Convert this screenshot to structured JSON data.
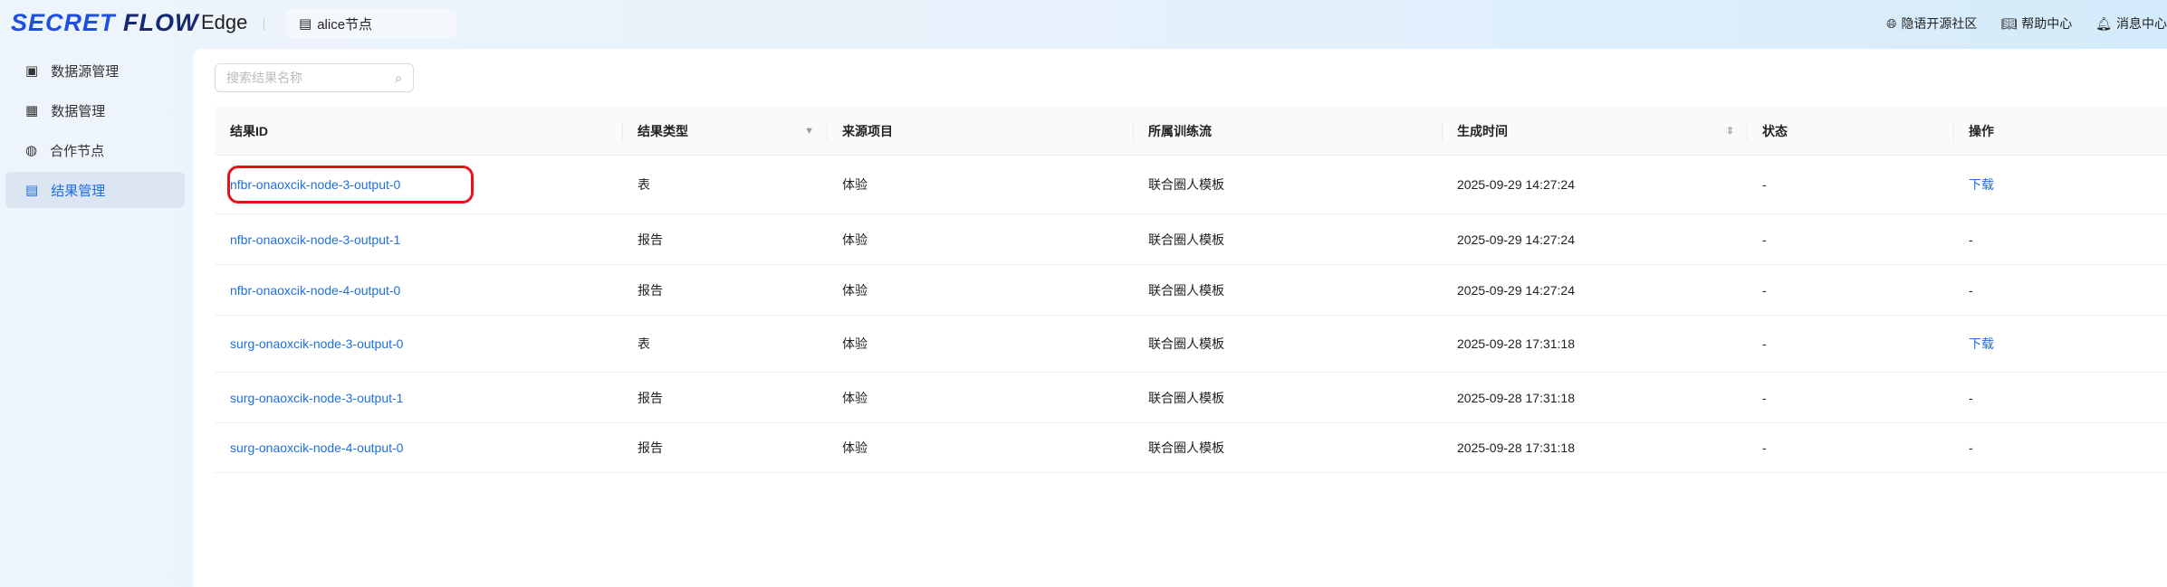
{
  "header": {
    "logo": "SECRET FLOW",
    "app": "Edge",
    "node": "alice节点",
    "links": [
      {
        "icon": "globe-icon",
        "label": "隐语开源社区"
      },
      {
        "icon": "book-icon",
        "label": "帮助中心"
      },
      {
        "icon": "bell-icon",
        "label": "消息中心"
      }
    ]
  },
  "sidebar": {
    "items": [
      {
        "label": "数据源管理"
      },
      {
        "label": "数据管理"
      },
      {
        "label": "合作节点"
      },
      {
        "label": "结果管理",
        "active": true
      }
    ]
  },
  "search": {
    "placeholder": "搜索结果名称"
  },
  "table": {
    "columns": [
      "结果ID",
      "结果类型",
      "来源项目",
      "所属训练流",
      "生成时间",
      "状态",
      "操作"
    ],
    "rows": [
      {
        "id": "nfbr-onaoxcik-node-3-output-0",
        "type": "表",
        "project": "体验",
        "flow": "联合圈人模板",
        "time": "2025-09-29 14:27:24",
        "status": "-",
        "action": "下载"
      },
      {
        "id": "nfbr-onaoxcik-node-3-output-1",
        "type": "报告",
        "project": "体验",
        "flow": "联合圈人模板",
        "time": "2025-09-29 14:27:24",
        "status": "-",
        "action": "-"
      },
      {
        "id": "nfbr-onaoxcik-node-4-output-0",
        "type": "报告",
        "project": "体验",
        "flow": "联合圈人模板",
        "time": "2025-09-29 14:27:24",
        "status": "-",
        "action": "-"
      },
      {
        "id": "surg-onaoxcik-node-3-output-0",
        "type": "表",
        "project": "体验",
        "flow": "联合圈人模板",
        "time": "2025-09-28 17:31:18",
        "status": "-",
        "action": "下载"
      },
      {
        "id": "surg-onaoxcik-node-3-output-1",
        "type": "报告",
        "project": "体验",
        "flow": "联合圈人模板",
        "time": "2025-09-28 17:31:18",
        "status": "-",
        "action": "-"
      },
      {
        "id": "surg-onaoxcik-node-4-output-0",
        "type": "报告",
        "project": "体验",
        "flow": "联合圈人模板",
        "time": "2025-09-28 17:31:18",
        "status": "-",
        "action": "-"
      }
    ]
  },
  "colors": {
    "accent": "#1f6fe0",
    "highlight": "#e4141b"
  }
}
